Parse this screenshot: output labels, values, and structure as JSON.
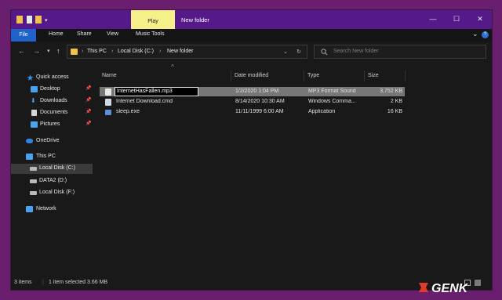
{
  "titlebar": {
    "play_tab": "Play",
    "title": "New folder",
    "minimize": "—",
    "maximize": "☐",
    "close": "✕"
  },
  "ribbon": {
    "file": "File",
    "tabs": [
      "Home",
      "Share",
      "View",
      "Music Tools"
    ],
    "chevron": "⌄",
    "help": "?"
  },
  "nav": {
    "back": "←",
    "forward": "→",
    "recent": "▾",
    "up": "↑",
    "breadcrumbs": [
      "This PC",
      "Local Disk (C:)",
      "New folder"
    ],
    "separator": "›",
    "dropdown": "⌄",
    "refresh": "↻",
    "search_placeholder": "Search New folder"
  },
  "sidebar": {
    "items": [
      {
        "label": "Quick access",
        "icon": "star-icon",
        "color": "#3d8ee8",
        "pinned": false
      },
      {
        "label": "Desktop",
        "icon": "desktop-icon",
        "color": "#4aa3f0",
        "pinned": true
      },
      {
        "label": "Downloads",
        "icon": "download-icon",
        "color": "#4aa3f0",
        "pinned": true
      },
      {
        "label": "Documents",
        "icon": "document-icon",
        "color": "#d6d6d6",
        "pinned": true
      },
      {
        "label": "Pictures",
        "icon": "pictures-icon",
        "color": "#4aa3f0",
        "pinned": true
      },
      {
        "label": "OneDrive",
        "icon": "cloud-icon",
        "color": "#2f86e0",
        "pinned": false
      },
      {
        "label": "This PC",
        "icon": "computer-icon",
        "color": "#4aa3f0",
        "pinned": false
      },
      {
        "label": "Local Disk (C:)",
        "icon": "drive-icon",
        "color": "#b8b8b8",
        "pinned": false,
        "selected": true
      },
      {
        "label": "DATA2 (D:)",
        "icon": "drive-icon",
        "color": "#b8b8b8",
        "pinned": false
      },
      {
        "label": "Local Disk (F:)",
        "icon": "drive-icon",
        "color": "#b8b8b8",
        "pinned": false
      },
      {
        "label": "Network",
        "icon": "network-icon",
        "color": "#4aa3f0",
        "pinned": false
      }
    ],
    "pin_glyph": "📌"
  },
  "columns": [
    "Name",
    "Date modified",
    "Type",
    "Size"
  ],
  "sort_glyph": "^",
  "files": [
    {
      "name": "InternetHasFallen.mp3",
      "date": "1/2/2020 1:04 PM",
      "type": "MP3 Format Sound",
      "size": "3,752 KB",
      "icon": "audio-file-icon",
      "selected": true
    },
    {
      "name": "Internet Download.cmd",
      "date": "8/14/2020 10:30 AM",
      "type": "Windows Comma...",
      "size": "2 KB",
      "icon": "script-file-icon"
    },
    {
      "name": "sleep.exe",
      "date": "11/11/1999 6:00 AM",
      "type": "Application",
      "size": "16 KB",
      "icon": "application-icon"
    }
  ],
  "status": {
    "count": "3 items",
    "selection": "1 item selected  3.66 MB"
  },
  "watermark": "GENK",
  "colors": {
    "accent": "#56198a",
    "file_tab": "#1f62c9",
    "play_tab": "#f6f08a",
    "selection": "#777777",
    "background": "#191919"
  }
}
